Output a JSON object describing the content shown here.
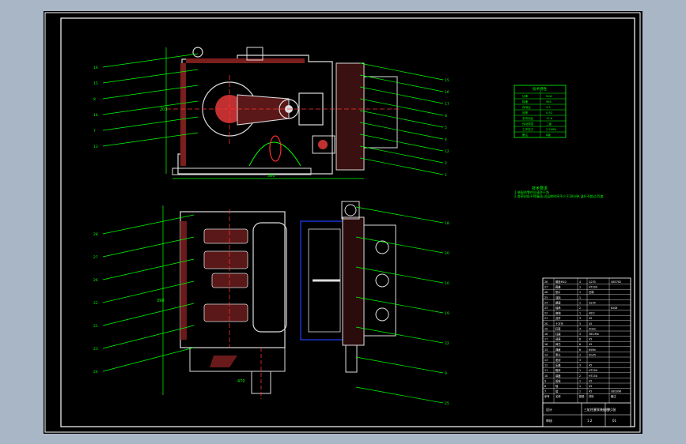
{
  "background": "#000000",
  "frame_color": "#ffffff",
  "leader_color": "#00ff00",
  "part_color": "#ff3030",
  "hatch_color": "#c03030",
  "dim_color": "#00ff00",
  "blue_color": "#2040ff",
  "yellow_color": "#ffff00",
  "tech_table": {
    "header": "技术特性",
    "rows": [
      {
        "k": "功率",
        "v": "5kW"
      },
      {
        "k": "转速",
        "v": "960"
      },
      {
        "k": "传动比",
        "v": "3.5"
      },
      {
        "k": "效率",
        "v": "0.92"
      },
      {
        "k": "总传动比",
        "v": "12.6"
      },
      {
        "k": "传动特性",
        "v": "二级"
      },
      {
        "k": "工作压力",
        "v": "2.5MPa"
      },
      {
        "k": "备注",
        "v": "6级"
      }
    ]
  },
  "tech_notes": {
    "title": "技术要求",
    "lines": [
      "1.装配前零件应清洗干净",
      "2.各密封处不得漏油,试运转时间不少于30分钟,温升不超过35度"
    ]
  },
  "parts_list": {
    "rows": [
      [
        "28",
        "螺栓M10",
        "4",
        "Q235",
        "GB5782"
      ],
      [
        "27",
        "箱盖",
        "1",
        "HT200",
        ""
      ],
      [
        "26",
        "垫片",
        "1",
        "石棉",
        ""
      ],
      [
        "25",
        "油标",
        "1",
        "",
        ""
      ],
      [
        "24",
        "螺塞",
        "1",
        "Q235",
        ""
      ],
      [
        "23",
        "轴承",
        "2",
        "",
        "6208"
      ],
      [
        "22",
        "曲轴",
        "1",
        "40Cr",
        ""
      ],
      [
        "21",
        "连杆",
        "3",
        "45",
        ""
      ],
      [
        "20",
        "十字头",
        "3",
        "45",
        ""
      ],
      [
        "19",
        "缸套",
        "3",
        "ZQSn",
        ""
      ],
      [
        "18",
        "柱塞",
        "3",
        "38CrMo",
        ""
      ],
      [
        "17",
        "阀座",
        "6",
        "45",
        ""
      ],
      [
        "16",
        "阀芯",
        "6",
        "45",
        ""
      ],
      [
        "15",
        "弹簧",
        "6",
        "65Mn",
        ""
      ],
      [
        "14",
        "泵头",
        "1",
        "ZG35",
        ""
      ],
      [
        "13",
        "密封",
        "3",
        "",
        ""
      ],
      [
        "12",
        "压盖",
        "3",
        "45",
        ""
      ],
      [
        "11",
        "箱体",
        "1",
        "HT200",
        ""
      ],
      [
        "10",
        "端盖",
        "2",
        "HT150",
        ""
      ],
      [
        "9",
        "齿轮",
        "1",
        "45",
        ""
      ],
      [
        "8",
        "轴",
        "1",
        "45",
        ""
      ],
      [
        "7",
        "键",
        "1",
        "45",
        "GB1096"
      ]
    ],
    "header": [
      "序号",
      "名称",
      "数量",
      "材料",
      "备注"
    ]
  },
  "title_block": {
    "title": "三缸柱塞泵装配图",
    "scale": "1:2",
    "designer": "设计",
    "checker": "审核",
    "sheet": "共1张",
    "no": "01"
  },
  "callouts_top_left": [
    "16",
    "15",
    "8",
    "14",
    "7",
    "13"
  ],
  "callouts_top_right": [
    "15",
    "16",
    "17",
    "8",
    "5",
    "4",
    "12",
    "2",
    "1"
  ],
  "callouts_bottom_left": [
    "28",
    "27",
    "26",
    "22",
    "21",
    "23",
    "24"
  ],
  "callouts_bottom_right": [
    "18",
    "20",
    "10",
    "19",
    "22",
    "9",
    "25"
  ],
  "dims": {
    "width_top": "380",
    "width_bottom": "470",
    "height_top": "203",
    "height_bottom": "390"
  }
}
